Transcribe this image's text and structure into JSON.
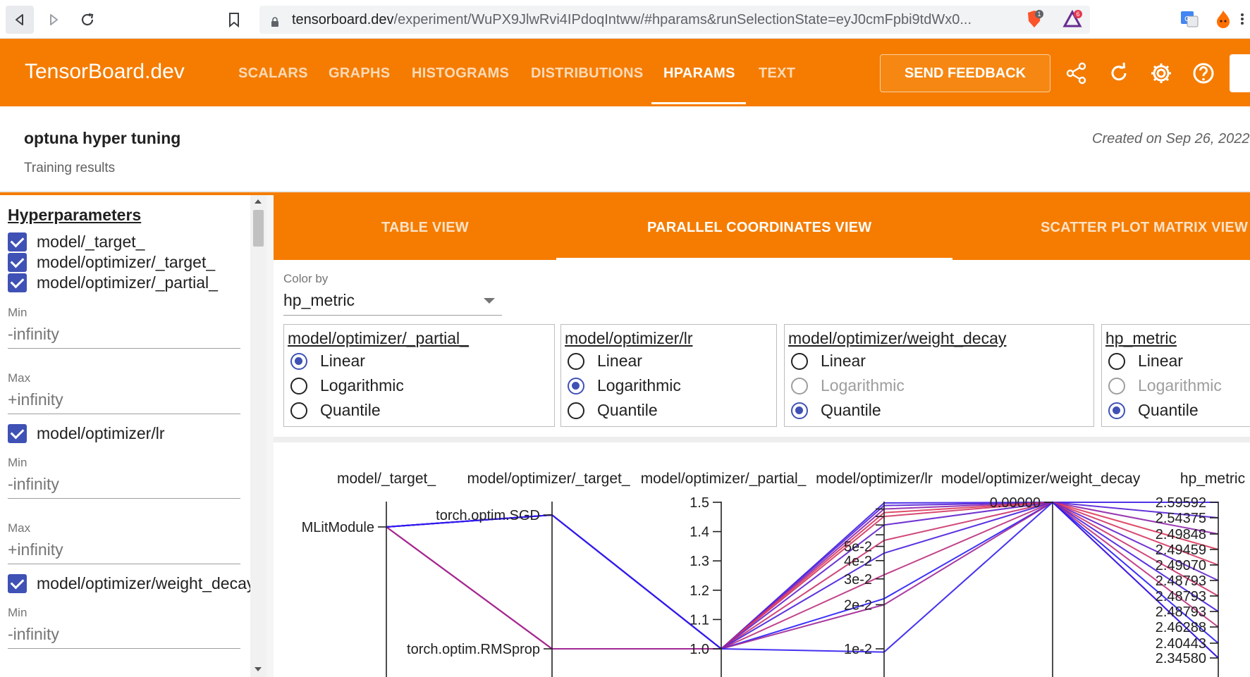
{
  "browser": {
    "url_host": "tensorboard.dev",
    "url_path": "/experiment/WuPX9JlwRvi4IPdoqIntww/#hparams&runSelectionState=eyJ0cmFpbi9tdWx0...",
    "ext_badges": [
      "1",
      "6"
    ]
  },
  "header": {
    "logo": "TensorBoard.dev",
    "tabs": [
      {
        "label": "SCALARS",
        "active": false
      },
      {
        "label": "GRAPHS",
        "active": false
      },
      {
        "label": "HISTOGRAMS",
        "active": false
      },
      {
        "label": "DISTRIBUTIONS",
        "active": false
      },
      {
        "label": "HPARAMS",
        "active": true
      },
      {
        "label": "TEXT",
        "active": false
      }
    ],
    "feedback_label": "SEND FEEDBACK"
  },
  "experiment": {
    "title": "optuna hyper tuning",
    "description": "Training results",
    "created": "Created on Sep 26, 2022"
  },
  "sidebar": {
    "heading": "Hyperparameters",
    "items": [
      {
        "label": "model/_target_",
        "checked": true
      },
      {
        "label": "model/optimizer/_target_",
        "checked": true
      },
      {
        "label": "model/optimizer/_partial_",
        "checked": true
      },
      {
        "label": "model/optimizer/lr",
        "checked": true
      },
      {
        "label": "model/optimizer/weight_decay",
        "checked": true
      }
    ],
    "min_label": "Min",
    "max_label": "Max",
    "min_value": "-infinity",
    "max_value": "+infinity"
  },
  "view_tabs": [
    {
      "label": "TABLE VIEW",
      "active": false
    },
    {
      "label": "PARALLEL COORDINATES VIEW",
      "active": true
    },
    {
      "label": "SCATTER PLOT MATRIX VIEW",
      "active": false
    }
  ],
  "color_by": {
    "label": "Color by",
    "value": "hp_metric"
  },
  "scale_options": {
    "option_labels": [
      "Linear",
      "Logarithmic",
      "Quantile"
    ],
    "columns": [
      {
        "title": "model/optimizer/_partial_",
        "selected": "Linear",
        "disabled": []
      },
      {
        "title": "model/optimizer/lr",
        "selected": "Logarithmic",
        "disabled": []
      },
      {
        "title": "model/optimizer/weight_decay",
        "selected": "Quantile",
        "disabled": [
          "Logarithmic"
        ]
      },
      {
        "title": "hp_metric",
        "selected": "Quantile",
        "disabled": [
          "Logarithmic"
        ]
      }
    ]
  },
  "parallel_plot": {
    "axis_titles": [
      "model/_target_",
      "model/optimizer/_target_",
      "model/optimizer/_partial_",
      "model/optimizer/lr",
      "model/optimizer/weight_decay",
      "hp_metric"
    ],
    "target_ticks": [
      "MLitModule"
    ],
    "optimizer_target_ticks": [
      "torch.optim.SGD",
      "torch.optim.RMSprop"
    ],
    "partial_ticks": [
      "1.5",
      "1.4",
      "1.3",
      "1.2",
      "1.1",
      "1.0"
    ],
    "lr_ticks": [
      "5e-2",
      "4e-2",
      "3e-2",
      "2e-2",
      "1e-2"
    ],
    "weight_decay_ticks": [
      "0.00000"
    ],
    "hp_metric_ticks": [
      "2.59592",
      "2.54375",
      "2.49848",
      "2.49459",
      "2.49070",
      "2.48793",
      "2.48793",
      "2.48793",
      "2.46288",
      "2.40443",
      "2.34580"
    ],
    "colors": {
      "low": "#1a1aff",
      "mid": "#8e24aa",
      "high": "#e53950"
    }
  }
}
